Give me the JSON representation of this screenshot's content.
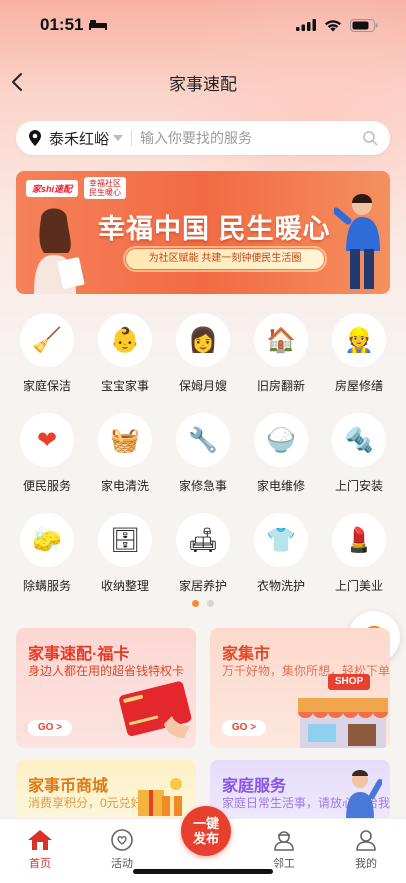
{
  "status_bar": {
    "time": "01:51"
  },
  "nav": {
    "title": "家事速配"
  },
  "search": {
    "city": "泰禾红峪",
    "placeholder": "输入你要找的服务"
  },
  "banner": {
    "logo_left": "家shi速配",
    "logo_right_line1": "幸福社区",
    "logo_right_line2": "民生暖心",
    "title": "幸福中国 民生暖心",
    "subtitle": "为社区赋能 共建一刻钟便民生活圈"
  },
  "services": [
    [
      {
        "label": "家庭保洁",
        "icon": "cleaner-icon",
        "glyph": "🧹"
      },
      {
        "label": "宝宝家事",
        "icon": "baby-icon",
        "glyph": "👶"
      },
      {
        "label": "保姆月嫂",
        "icon": "nanny-icon",
        "glyph": "👩"
      },
      {
        "label": "旧房翻新",
        "icon": "renovation-icon",
        "glyph": "🏠"
      },
      {
        "label": "房屋修缮",
        "icon": "repair-worker-icon",
        "glyph": "👷"
      }
    ],
    [
      {
        "label": "便民服务",
        "icon": "heart-hands-icon",
        "glyph": "❤"
      },
      {
        "label": "家电清洗",
        "icon": "washing-machine-icon",
        "glyph": "🧺"
      },
      {
        "label": "家修急事",
        "icon": "wrench-icon",
        "glyph": "🔧"
      },
      {
        "label": "家电维修",
        "icon": "rice-cooker-icon",
        "glyph": "🍚"
      },
      {
        "label": "上门安装",
        "icon": "drill-icon",
        "glyph": "🔩"
      }
    ],
    [
      {
        "label": "除螨服务",
        "icon": "vacuum-icon",
        "glyph": "🧽"
      },
      {
        "label": "收纳整理",
        "icon": "cabinet-icon",
        "glyph": "🗄"
      },
      {
        "label": "家居养护",
        "icon": "sofa-icon",
        "glyph": "🛋"
      },
      {
        "label": "衣物洗护",
        "icon": "sweater-icon",
        "glyph": "👕"
      },
      {
        "label": "上门美业",
        "icon": "makeup-brush-icon",
        "glyph": "💄"
      }
    ]
  ],
  "pagination": {
    "pages": 2,
    "active": 1
  },
  "cards": {
    "fuka": {
      "title": "家事速配·福卡",
      "subtitle": "身边人都在用的超省钱特权卡",
      "go": "GO >"
    },
    "jiaji": {
      "title": "家集市",
      "subtitle": "万千好物，集你所想，轻松下单",
      "go": "GO >",
      "shop_sign": "SHOP"
    },
    "mall": {
      "title": "家事币商城",
      "subtitle": "消费享积分，0元兑好礼"
    },
    "home_service": {
      "title": "家庭服务",
      "subtitle": "家庭日常生活事，请放心交给我"
    }
  },
  "tabbar": {
    "home": "首页",
    "activity": "活动",
    "publish": "一键发布",
    "publish_line1": "一键",
    "publish_line2": "发布",
    "workers": "邻工",
    "mine": "我的"
  },
  "colors": {
    "accent": "#e8402f",
    "tab_active": "#d8332a",
    "pager_active": "#f18a3a"
  }
}
